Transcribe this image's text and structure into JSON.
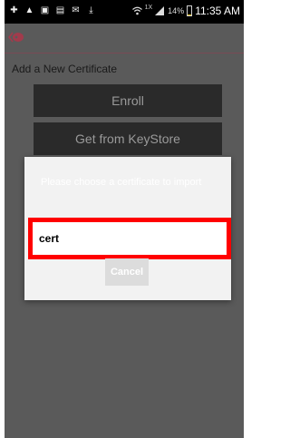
{
  "status_bar": {
    "icons_left": [
      "plus-icon",
      "warning-icon",
      "image-icon",
      "news-icon",
      "mail-icon",
      "download-icon"
    ],
    "signal_label": "1X",
    "battery_percent": "14%",
    "battery_level": 0.14,
    "time": "11:35 AM"
  },
  "app": {
    "icon": "app-icon",
    "accent_color": "#7a2d3a"
  },
  "main": {
    "section_title": "Add a New Certificate",
    "enroll_label": "Enroll",
    "keystore_label": "Get from KeyStore"
  },
  "dialog": {
    "message": "Please choose a certificate to import",
    "input_value": "cert",
    "cancel_label": "Cancel",
    "highlight_color": "#ff0000"
  }
}
